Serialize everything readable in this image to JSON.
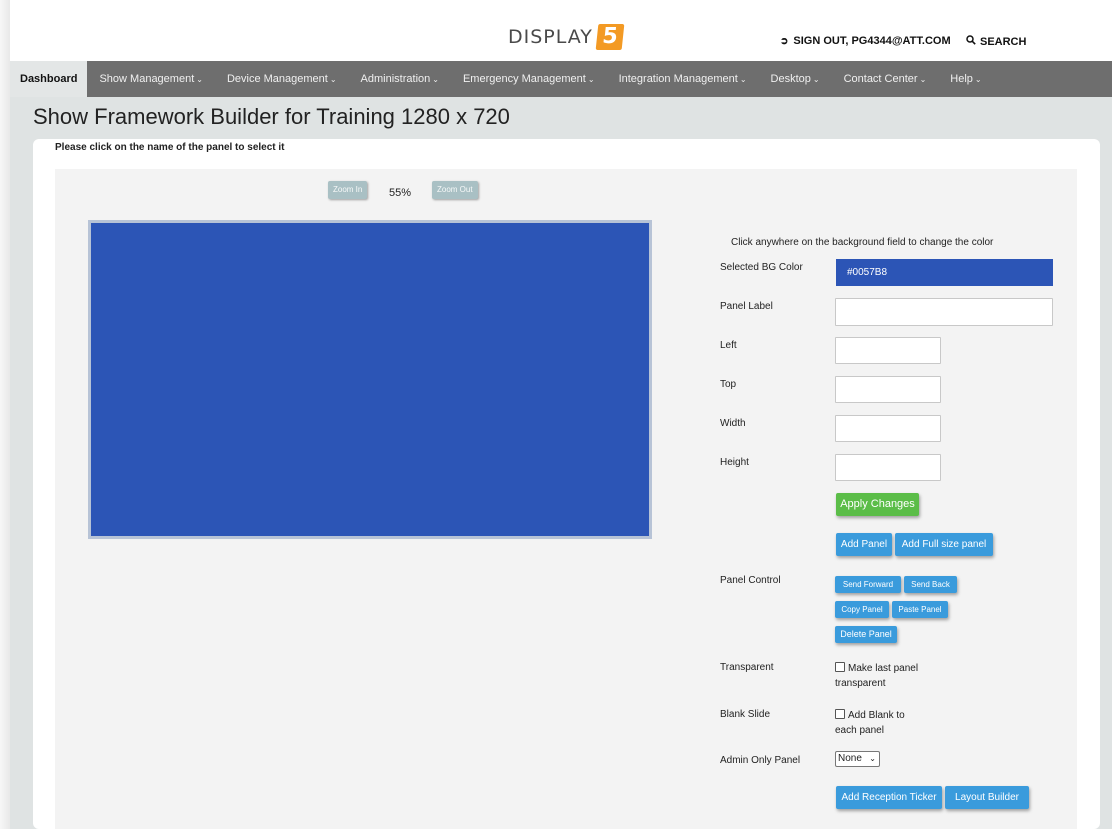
{
  "header": {
    "logo_word": "DISPLAY",
    "logo_mark": "5",
    "sign_out_label": "SIGN OUT, PG4344@ATT.COM",
    "search_label": "SEARCH",
    "icons": {
      "sign_out": "sign-out-icon",
      "search": "search-icon"
    }
  },
  "nav": {
    "items": [
      {
        "label": "Dashboard",
        "caret": ""
      },
      {
        "label": "Show Management",
        "caret": "⌄"
      },
      {
        "label": "Device Management",
        "caret": "⌄"
      },
      {
        "label": "Administration",
        "caret": "⌄"
      },
      {
        "label": "Emergency Management",
        "caret": "⌄"
      },
      {
        "label": "Integration Management",
        "caret": " ⌄"
      },
      {
        "label": "Desktop",
        "caret": "⌄"
      },
      {
        "label": "Contact Center",
        "caret": " ⌄"
      },
      {
        "label": "Help",
        "caret": "⌄"
      }
    ],
    "active_index": 0
  },
  "page": {
    "title": "Show Framework Builder for Training 1280 x 720",
    "hint": "Please click on the name of the panel to select it"
  },
  "zoom": {
    "zoom_in_label": "Zoom In",
    "zoom_out_label": "Zoom Out",
    "percent": "55%"
  },
  "canvas": {
    "background_color": "#2c55b6"
  },
  "form": {
    "instruction": "Click anywhere on the background field to change the color",
    "bg_color_label": "Selected BG Color",
    "bg_color_value": "#0057B8",
    "panel_label_label": "Panel Label",
    "panel_label_value": "",
    "left_label": "Left",
    "left_value": "",
    "top_label": "Top",
    "top_value": "",
    "width_label": "Width",
    "width_value": "",
    "height_label": "Height",
    "height_value": "",
    "apply_changes": "Apply Changes",
    "add_panel": "Add Panel",
    "add_full_size_panel": "Add Full size panel",
    "panel_control_label": "Panel Control",
    "send_forward": "Send Forward",
    "send_back": "Send Back",
    "copy_panel": "Copy Panel",
    "paste_panel": "Paste Panel",
    "delete_panel": "Delete Panel",
    "transparent_label": "Transparent",
    "transparent_line1": "Make last panel",
    "transparent_line2": "transparent",
    "transparent_checked": false,
    "blank_slide_label": "Blank Slide",
    "blank_line1": "Add Blank to",
    "blank_line2": "each panel",
    "blank_checked": false,
    "admin_only_label": "Admin Only Panel",
    "admin_only_value": "None",
    "add_reception_ticker": "Add Reception Ticker",
    "layout_builder": "Layout Builder"
  },
  "colors": {
    "nav_bg": "#6e6e6e",
    "primary_button": "#3a9bdc",
    "apply_button": "#5bbd48",
    "logo_accent": "#f39a24",
    "selected_bg": "#2c55b6"
  }
}
